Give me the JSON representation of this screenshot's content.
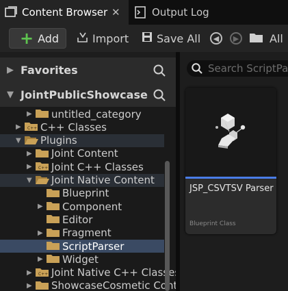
{
  "tabs": [
    {
      "label": "Content Browser",
      "icon": "content-browser-icon",
      "active": true
    },
    {
      "label": "Output Log",
      "icon": "output-log-icon",
      "active": false
    }
  ],
  "tab_close": "✕",
  "toolbar": {
    "add_label": "Add",
    "import_label": "Import",
    "save_all_label": "Save All",
    "path_label": "All"
  },
  "favorites": {
    "label": "Favorites"
  },
  "project": {
    "label": "JointPublicShowcase"
  },
  "tree": [
    {
      "label": "untitled_category",
      "depth": 1,
      "expanded": false,
      "state": "normal",
      "folder": "plain"
    },
    {
      "label": "C++ Classes",
      "depth": 0,
      "expanded": false,
      "state": "normal",
      "folder": "cpp"
    },
    {
      "label": "Plugins",
      "depth": 0,
      "expanded": true,
      "state": "open",
      "folder": "open"
    },
    {
      "label": "Joint Content",
      "depth": 1,
      "expanded": false,
      "state": "normal",
      "folder": "plain"
    },
    {
      "label": "Joint C++ Classes",
      "depth": 1,
      "expanded": false,
      "state": "normal",
      "folder": "cpp"
    },
    {
      "label": "Joint Native Content",
      "depth": 1,
      "expanded": true,
      "state": "open",
      "folder": "open"
    },
    {
      "label": "Blueprint",
      "depth": 2,
      "expanded": null,
      "state": "normal",
      "folder": "plain"
    },
    {
      "label": "Component",
      "depth": 2,
      "expanded": false,
      "state": "normal",
      "folder": "plain"
    },
    {
      "label": "Editor",
      "depth": 2,
      "expanded": null,
      "state": "normal",
      "folder": "plain"
    },
    {
      "label": "Fragment",
      "depth": 2,
      "expanded": false,
      "state": "normal",
      "folder": "plain"
    },
    {
      "label": "ScriptParser",
      "depth": 2,
      "expanded": null,
      "state": "selected",
      "folder": "plain"
    },
    {
      "label": "Widget",
      "depth": 2,
      "expanded": false,
      "state": "normal",
      "folder": "plain"
    },
    {
      "label": "Joint Native C++ Classes",
      "depth": 1,
      "expanded": false,
      "state": "normal",
      "folder": "cpp"
    },
    {
      "label": "ShowcaseCosmetic Content",
      "depth": 1,
      "expanded": false,
      "state": "normal",
      "folder": "plain"
    }
  ],
  "search": {
    "placeholder": "Search ScriptParser"
  },
  "asset": {
    "name": "JSP_CSVTSV Parser",
    "type": "Blueprint Class",
    "accent": "#4a7de8"
  },
  "colors": {
    "folder": "#c9a157",
    "folder_dark": "#a47f3c",
    "add_green": "#5ec350",
    "selection": "#3a4a63"
  }
}
